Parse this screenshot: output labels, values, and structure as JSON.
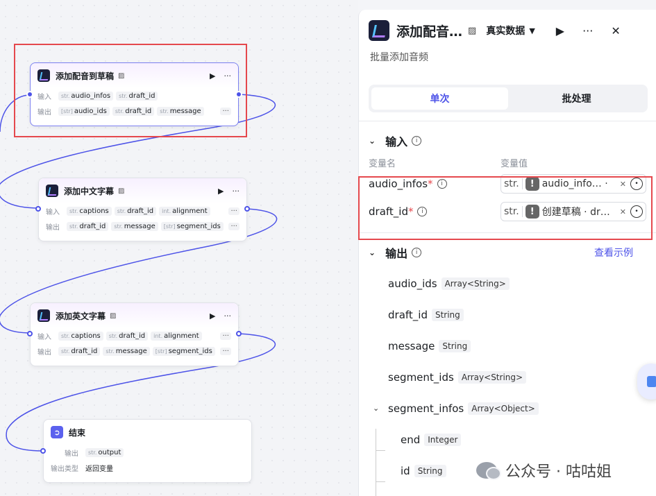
{
  "canvas": {
    "nodes": [
      {
        "title": "添加配音到草稿",
        "input_label": "输入",
        "output_label": "输出",
        "inputs": [
          {
            "type": "str.",
            "name": "audio_infos"
          },
          {
            "type": "str.",
            "name": "draft_id"
          }
        ],
        "outputs": [
          {
            "type": "[str]",
            "name": "audio_ids"
          },
          {
            "type": "str.",
            "name": "draft_id"
          },
          {
            "type": "str.",
            "name": "message"
          }
        ]
      },
      {
        "title": "添加中文字幕",
        "input_label": "输入",
        "output_label": "输出",
        "inputs": [
          {
            "type": "str.",
            "name": "captions"
          },
          {
            "type": "str.",
            "name": "draft_id"
          },
          {
            "type": "int.",
            "name": "alignment"
          }
        ],
        "outputs": [
          {
            "type": "str.",
            "name": "draft_id"
          },
          {
            "type": "str.",
            "name": "message"
          },
          {
            "type": "[str]",
            "name": "segment_ids"
          }
        ]
      },
      {
        "title": "添加英文字幕",
        "input_label": "输入",
        "output_label": "输出",
        "inputs": [
          {
            "type": "str.",
            "name": "captions"
          },
          {
            "type": "str.",
            "name": "draft_id"
          },
          {
            "type": "int.",
            "name": "alignment"
          }
        ],
        "outputs": [
          {
            "type": "str.",
            "name": "draft_id"
          },
          {
            "type": "str.",
            "name": "message"
          },
          {
            "type": "[str]",
            "name": "segment_ids"
          }
        ]
      }
    ],
    "end_node": {
      "title": "结束",
      "output_label": "输出",
      "output": {
        "type": "str.",
        "name": "output"
      },
      "output_type_label": "输出类型",
      "output_type_value": "返回变量"
    },
    "more_glyph": "···",
    "play_glyph": "▶"
  },
  "panel": {
    "title": "添加配音…",
    "data_mode": "真实数据",
    "description": "批量添加音频",
    "tabs": [
      "单次",
      "批处理"
    ],
    "input_section": {
      "title": "输入",
      "col_name": "变量名",
      "col_value": "变量值",
      "rows": [
        {
          "name": "audio_infos",
          "type": "str.",
          "value": "audio_info… ·"
        },
        {
          "name": "draft_id",
          "type": "str.",
          "value": "创建草稿 · dr…"
        }
      ]
    },
    "output_section": {
      "title": "输出",
      "link": "查看示例",
      "rows": [
        {
          "name": "audio_ids",
          "type": "Array<String>"
        },
        {
          "name": "draft_id",
          "type": "String"
        },
        {
          "name": "message",
          "type": "String"
        },
        {
          "name": "segment_ids",
          "type": "Array<String>"
        },
        {
          "name": "segment_infos",
          "type": "Array<Object>"
        }
      ],
      "children": [
        {
          "name": "end",
          "type": "Integer"
        },
        {
          "name": "id",
          "type": "String"
        }
      ]
    }
  },
  "watermark": "公众号 · 咕咕姐",
  "colors": {
    "accent": "#4d53e8",
    "highlight": "#e5484d"
  }
}
